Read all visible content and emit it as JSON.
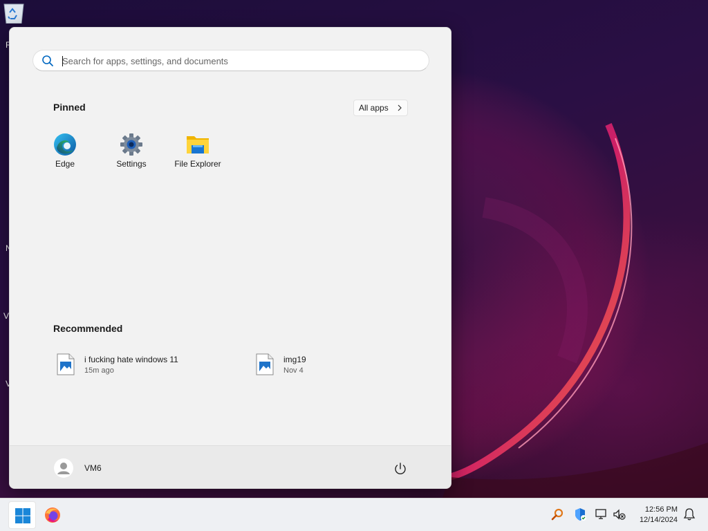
{
  "desktop": {
    "partial_labels": [
      "R",
      "N",
      "V",
      "V"
    ]
  },
  "start_menu": {
    "search": {
      "placeholder": "Search for apps, settings, and documents",
      "value": ""
    },
    "pinned": {
      "title": "Pinned",
      "all_apps_label": "All apps",
      "apps": [
        {
          "label": "Edge",
          "icon": "edge-icon"
        },
        {
          "label": "Settings",
          "icon": "gear-icon"
        },
        {
          "label": "File Explorer",
          "icon": "folder-icon"
        }
      ]
    },
    "recommended": {
      "title": "Recommended",
      "items": [
        {
          "name": "i fucking hate windows 11",
          "time": "15m ago",
          "icon": "image-file-icon"
        },
        {
          "name": "img19",
          "time": "Nov 4",
          "icon": "image-file-icon"
        }
      ]
    },
    "footer": {
      "user_name": "VM6",
      "power_icon": "power-icon"
    }
  },
  "taskbar": {
    "apps": [
      {
        "name": "start",
        "icon": "windows-logo-icon"
      },
      {
        "name": "firefox",
        "icon": "firefox-icon"
      }
    ],
    "tray_icons": [
      "search-key-icon",
      "defender-shield-icon",
      "network-disconnected-icon",
      "volume-muted-icon",
      "notification-bell-icon"
    ],
    "clock": {
      "time": "12:56 PM",
      "date": "12/14/2024"
    }
  },
  "colors": {
    "accent": "#0067c0",
    "menu_bg": "#f2f2f2",
    "taskbar_bg": "#eef0f3"
  }
}
